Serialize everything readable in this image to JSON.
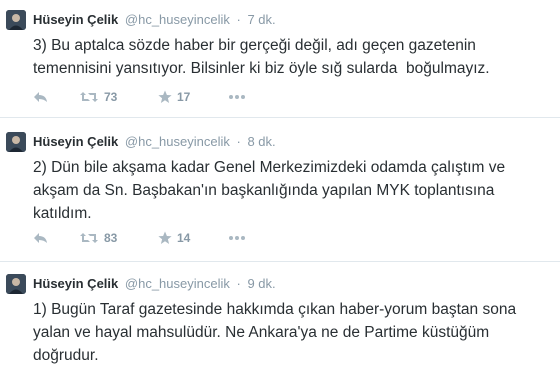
{
  "tweets": [
    {
      "name": "Hüseyin Çelik",
      "handle": "@hc_huseyincelik",
      "separator": "·",
      "time": "7 dk.",
      "text": "3) Bu aptalca sözde haber bir gerçeği değil, adı geçen gazetenin temennisini yansıtıyor. Bilsinler ki biz öyle sığ sularda  boğulmayız.",
      "retweets": "73",
      "favorites": "17",
      "icons": [
        "reply-icon",
        "retweet-icon",
        "favorite-icon",
        "more-icon"
      ]
    },
    {
      "name": "Hüseyin Çelik",
      "handle": "@hc_huseyincelik",
      "separator": "·",
      "time": "8 dk.",
      "text": "2) Dün bile akşama kadar Genel Merkezimizdeki odamda çalıştım ve akşam da Sn. Başbakan'ın başkanlığında yapılan MYK toplantısına katıldım.",
      "retweets": "83",
      "favorites": "14",
      "icons": [
        "reply-icon",
        "retweet-icon",
        "favorite-icon",
        "more-icon"
      ]
    },
    {
      "name": "Hüseyin Çelik",
      "handle": "@hc_huseyincelik",
      "separator": "·",
      "time": "9 dk.",
      "text": "1) Bugün Taraf gazetesinde hakkımda çıkan haber-yorum baştan sona yalan ve hayal mahsulüdür. Ne Ankara'ya ne de Partime küstüğüm doğrudur."
    }
  ],
  "colors": {
    "text": "#292f33",
    "meta": "#8899a6",
    "icon": "#aab8c2",
    "divider": "#e1e8ed"
  }
}
